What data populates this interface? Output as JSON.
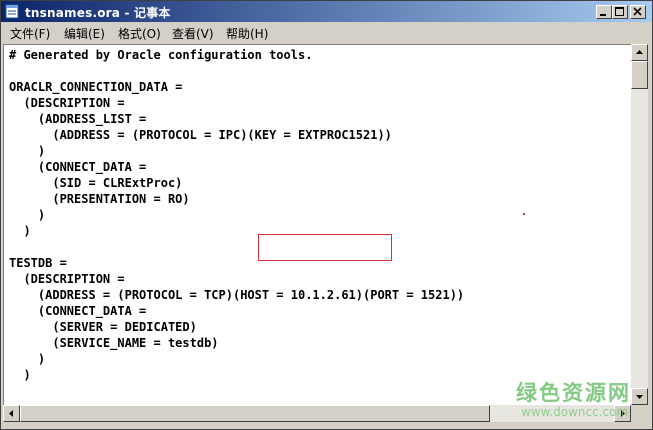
{
  "window": {
    "title": "tnsnames.ora - 记事本",
    "accent_color": "#0a246a",
    "controls": {
      "minimize_icon": "minimize-icon",
      "maximize_icon": "maximize-icon",
      "close_icon": "close-icon"
    }
  },
  "menu": {
    "items": [
      {
        "label": "文件(F)"
      },
      {
        "label": "编辑(E)"
      },
      {
        "label": "格式(O)"
      },
      {
        "label": "查看(V)"
      },
      {
        "label": "帮助(H)"
      }
    ]
  },
  "editor": {
    "lines": [
      "# Generated by Oracle configuration tools.",
      "",
      "ORACLR_CONNECTION_DATA =",
      "  (DESCRIPTION =",
      "    (ADDRESS_LIST =",
      "      (ADDRESS = (PROTOCOL = IPC)(KEY = EXTPROC1521))",
      "    )",
      "    (CONNECT_DATA =",
      "      (SID = CLRExtProc)",
      "      (PRESENTATION = RO)",
      "    )",
      "  )",
      "",
      "TESTDB =",
      "  (DESCRIPTION =",
      "    (ADDRESS = (PROTOCOL = TCP)(HOST = 10.1.2.61)(PORT = 1521))",
      "    (CONNECT_DATA =",
      "      (SERVER = DEDICATED)",
      "      (SERVICE_NAME = testdb)",
      "    )",
      "  )"
    ],
    "highlight_color": "#e0303a"
  },
  "watermark": {
    "brand": "绿色资源网",
    "url": "www.downcc.com",
    "color": "#5cb85c"
  }
}
